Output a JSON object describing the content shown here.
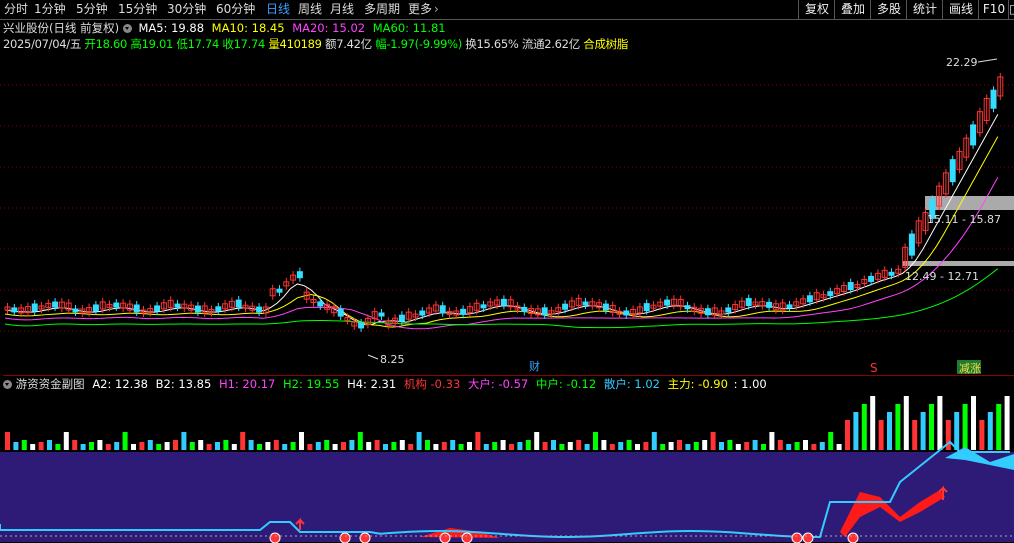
{
  "toolbar": {
    "tabs": [
      "分时",
      "1分钟",
      "5分钟",
      "15分钟",
      "30分钟",
      "60分钟",
      "日线",
      "周线",
      "月线",
      "多周期",
      "更多"
    ],
    "active_tab": "日线",
    "right_buttons": [
      "复权",
      "叠加",
      "多股",
      "统计",
      "画线",
      "F10",
      "□"
    ]
  },
  "stock": {
    "title": "兴业股份(日线 前复权)",
    "ma": [
      {
        "label": "MA5: 19.88",
        "color": "#ffffff"
      },
      {
        "label": "MA10: 18.45",
        "color": "#ffff00"
      },
      {
        "label": "MA20: 15.02",
        "color": "#ff44ff"
      },
      {
        "label": "MA60: 11.81",
        "color": "#00ff00"
      }
    ]
  },
  "quote": {
    "date": "2025/07/04/五",
    "open": "开18.60",
    "high": "高19.01",
    "low": "低17.74",
    "close": "收17.74",
    "volume": "量410189",
    "amount": "额7.42亿",
    "change": "幅-1.97(-9.99%)",
    "turnover": "换15.65%",
    "float": "流通2.62亿",
    "concept": "合成树脂"
  },
  "annotations": {
    "high_price": "22.29",
    "low_price": "8.25",
    "zone1": "15.11 - 15.87",
    "zone2": "12.49 - 12.71",
    "cai_marker": "财",
    "s_marker": "S",
    "limit_down": "减涨"
  },
  "indicator": {
    "title": "游资资金副图",
    "values": [
      {
        "label": "A2: 12.38",
        "color": "#ffffff"
      },
      {
        "label": "B2: 13.85",
        "color": "#ffffff"
      },
      {
        "label": "H1: 20.17",
        "color": "#ff44ff"
      },
      {
        "label": "H2: 19.55",
        "color": "#00ff00"
      },
      {
        "label": "H4: 2.31",
        "color": "#ffffff"
      },
      {
        "label": "机构 -0.33",
        "color": "#ff3333"
      },
      {
        "label": "大户: -0.57",
        "color": "#ff44ff"
      },
      {
        "label": "中户: -0.12",
        "color": "#00ff00"
      },
      {
        "label": "散户: 1.02",
        "color": "#33ccff"
      },
      {
        "label": "主力: -0.90",
        "color": "#ffff00"
      },
      {
        "label": ": 1.00",
        "color": "#ffffff"
      }
    ]
  },
  "colors": {
    "up": "#ff3333",
    "down": "#33ddff",
    "purple_area": "#2e1b78",
    "grid": "#8b0000"
  }
}
